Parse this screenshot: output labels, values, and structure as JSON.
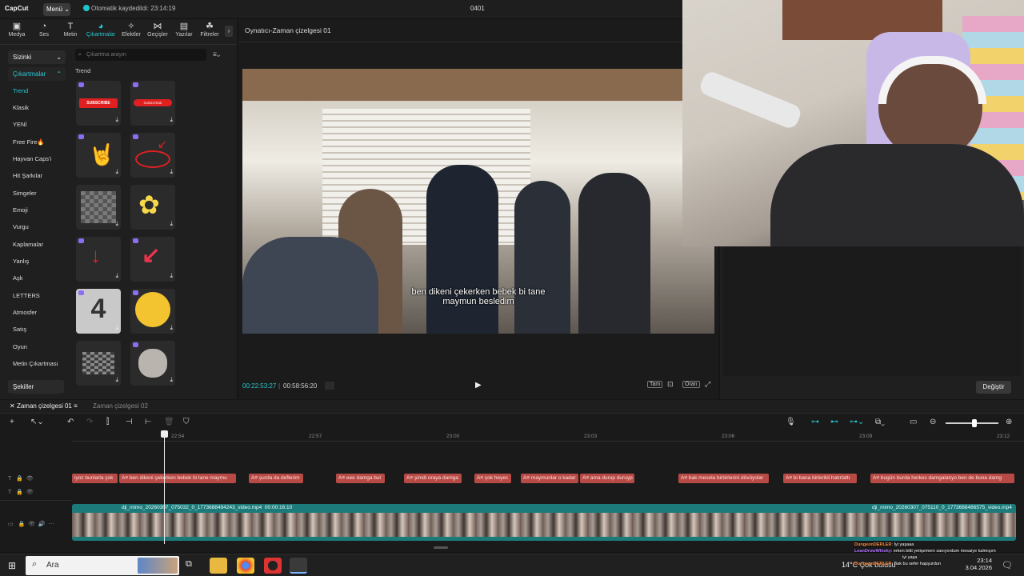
{
  "titlebar": {
    "logo": "CapCut",
    "menu_label": "Menü",
    "autosave": "Otomatik kaydedildi: 23:14:19",
    "project_name": "0401"
  },
  "toolbar": {
    "tabs": [
      {
        "label": "Medya",
        "icon": "media-icon"
      },
      {
        "label": "Ses",
        "icon": "audio-icon"
      },
      {
        "label": "Metin",
        "icon": "text-icon"
      },
      {
        "label": "Çıkartmalar",
        "icon": "sticker-icon",
        "active": true
      },
      {
        "label": "Efektler",
        "icon": "effects-icon"
      },
      {
        "label": "Geçişler",
        "icon": "transitions-icon"
      },
      {
        "label": "Yazılar",
        "icon": "captions-icon"
      },
      {
        "label": "Filtreler",
        "icon": "filters-icon"
      }
    ]
  },
  "stickers": {
    "sizinki": "Sizinki",
    "cikartmalar": "Çıkartmalar",
    "categories": [
      "Trend",
      "Klasik",
      "YENİ",
      "Free Fire🔥",
      "Hayvan Caps'i",
      "Hit Şarkılar",
      "Simgeler",
      "Emoji",
      "Vurgu",
      "Kaplamalar",
      "Yanlış",
      "Aşk",
      "LETTERS",
      "Atmosfer",
      "Satış",
      "Oyun",
      "Metin Çıkartması"
    ],
    "sekiller": "Şekiller",
    "search_placeholder": "Çıkartma arayın",
    "section_title": "Trend",
    "thumb_subscribe_1": "SUBSCRIBE",
    "thumb_subscribe_2": "SUBSCRIBE",
    "thumb_number": "4"
  },
  "player": {
    "title": "Oynatıcı-Zaman çizelgesi 01",
    "subtitle_line1": "ben dikeni çekerken bebek bi tane",
    "subtitle_line2": "maymun besledim",
    "time_current": "00:22:53:27",
    "time_total": "00:58:56:20",
    "tam_label": "Tam",
    "oran_label": "Oran"
  },
  "rightpanel": {
    "degistir_label": "Değiştir"
  },
  "timeline": {
    "tab_active": "Zaman çizelgesi 01",
    "tab_inactive": "Zaman çizelgesi 02",
    "ruler_ticks": [
      "22:54",
      "22:57",
      "23:00",
      "23:03",
      "23:06",
      "23:09",
      "23:12"
    ],
    "text_clips": [
      "iyoz bunlarla çok",
      "A≡ ben dikeni çekerken bebek bi tane maymu",
      "A≡ şurda da defterim",
      "A≡ eee damga bul",
      "A≡ şimdi oraya damga",
      "A≡ çok heyec",
      "A≡ maymunlar o kadar",
      "A≡ ama durup duruyp",
      "A≡ bak mesela birbirlerini dövüyolar",
      "A≡ bi bana birlerikli hatırlattı",
      "A≡ bugün burda herkes damgalatıyo ben de buna damg"
    ],
    "video_label_1": "dji_mimo_20260307_075032_0_1773688494243_video.mp4",
    "video_duration_1": "00:00:16:10",
    "video_label_2": "dji_mimo_20260307_075110_0_1773688486575_video.mp4"
  },
  "taskbar": {
    "search_label": "Ara",
    "weather": "14°C Çok bulutlu",
    "time": "23:14",
    "date": "3.04.2026"
  },
  "chat": [
    {
      "user": "DungeonDERLER",
      "text": ": İyi yaşaaa",
      "color": "#ff8a3d"
    },
    {
      "user": "LeanDrowWhisky",
      "text": ": erken bitti yetişemem sanıyordum mesaiye kalmışım",
      "color": "#b377ff"
    },
    {
      "user": "",
      "text": "iyi yaşa",
      "color": "#ffffff"
    },
    {
      "user": "DungeonDERLER",
      "text": ": Bak bu sefer hapşurdun",
      "color": "#ff8a3d"
    }
  ],
  "colors": {
    "accent": "#2ac6d0",
    "text_clip": "#b84a46",
    "video_track": "#1d7a7a"
  }
}
